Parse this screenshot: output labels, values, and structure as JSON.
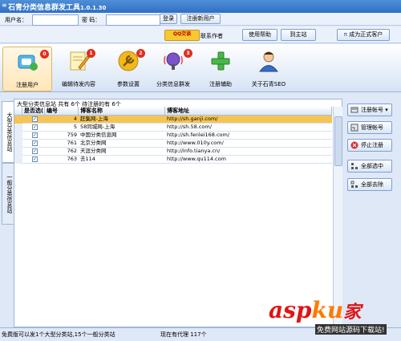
{
  "window": {
    "title": "石青分类信息群发工具",
    "version": "1.0.1.30"
  },
  "login": {
    "username_label": "用户名：",
    "password_label": "密  码：",
    "username_value": "",
    "password_value": "",
    "login_button": "登录",
    "register_button": "注册新用户"
  },
  "row2": {
    "qq_chat": "QQ交谈",
    "contact_author": "联系作者",
    "help": "使用帮助",
    "home": "到主站",
    "upgrade": "成为正式客户"
  },
  "toolbar": {
    "items": [
      {
        "label": "注册用户",
        "badge": "0",
        "icon": "register-user-icon"
      },
      {
        "label": "编辑待发内容",
        "badge": "1",
        "icon": "edit-content-icon"
      },
      {
        "label": "参数设置",
        "badge": "2",
        "icon": "settings-icon"
      },
      {
        "label": "分类信息群发",
        "badge": "3",
        "icon": "broadcast-icon"
      },
      {
        "label": "注册辅助",
        "badge": "",
        "icon": "register-assist-icon"
      },
      {
        "label": "关于石青SEO",
        "badge": "",
        "icon": "about-icon"
      }
    ]
  },
  "side_tabs": [
    "大型分类信息站",
    "一般分类信息站"
  ],
  "panel": {
    "caption": "大型分类信息站 共有 6个 待注册的有 6个",
    "columns": [
      "是否选(",
      "编号",
      "博客名称",
      "博客地址"
    ],
    "rows": [
      {
        "checked": true,
        "id": "4",
        "name": "赶集网-上海",
        "url": "http://sh.ganji.com/",
        "selected": true
      },
      {
        "checked": true,
        "id": "5",
        "name": "58同城网-上海",
        "url": "http://sh.58.com/",
        "selected": false
      },
      {
        "checked": true,
        "id": "759",
        "name": "中国分类信息网",
        "url": "http://sh.fenlei168.com/",
        "selected": false
      },
      {
        "checked": true,
        "id": "761",
        "name": "北京分类网",
        "url": "http://www.010y.com/",
        "selected": false
      },
      {
        "checked": true,
        "id": "762",
        "name": "天涯分类网",
        "url": "http://info.tianya.cn/",
        "selected": false
      },
      {
        "checked": true,
        "id": "763",
        "name": "去114",
        "url": "http://www.qu114.com",
        "selected": false
      }
    ]
  },
  "right_buttons": [
    {
      "label": "注册帐号 ▾",
      "icon": "register-account-icon"
    },
    {
      "label": "管理帐号",
      "icon": "manage-account-icon"
    },
    {
      "label": "停止注册",
      "icon": "stop-icon"
    },
    {
      "label": "全部选中",
      "icon": "select-all-icon"
    },
    {
      "label": "全部去除",
      "icon": "deselect-all-icon"
    }
  ],
  "status": {
    "left": "免费版可以发1个大型分类站,15个一般分类站",
    "right": "现在有代理 117个"
  },
  "watermark": {
    "brand_main": "asp",
    "brand_ku": "ku",
    "brand_jia": "家",
    "subtitle": "免费网站源码下载站!"
  }
}
